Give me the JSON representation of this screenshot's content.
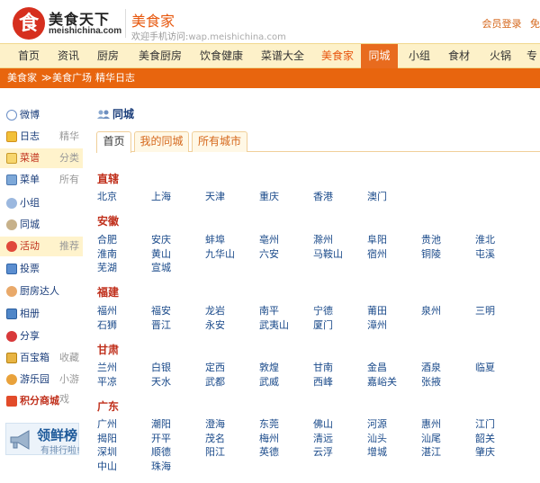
{
  "header": {
    "logo_mark": "食",
    "logo_name": "美食天下",
    "logo_domain": "meishichina.com",
    "site_title": "美食家",
    "site_sub_prefix": "欢迎手机访问:",
    "site_sub_wap": "wap.meishichina.com",
    "top_links": [
      "会员登录",
      "免"
    ]
  },
  "nav": {
    "items": [
      {
        "label": "首页"
      },
      {
        "label": "资讯"
      },
      {
        "label": "厨房"
      },
      {
        "label": "美食厨房"
      },
      {
        "label": "饮食健康"
      },
      {
        "label": "菜谱大全"
      },
      {
        "label": "美食家"
      },
      {
        "label": "同城"
      },
      {
        "label": "小组"
      },
      {
        "label": "食材"
      },
      {
        "label": "火锅"
      },
      {
        "label": "专"
      }
    ]
  },
  "subnav": {
    "items": [
      "美食家",
      "美食广场",
      "精华日志"
    ],
    "separator": "≫"
  },
  "sidebar": {
    "items": [
      {
        "label": "微博",
        "extra": "",
        "icon": "weibo-icon"
      },
      {
        "label": "日志",
        "extra": "精华",
        "icon": "log-icon"
      },
      {
        "label": "菜谱",
        "extra": "分类",
        "icon": "recipe-icon"
      },
      {
        "label": "菜单",
        "extra": "所有",
        "icon": "menu-icon"
      },
      {
        "label": "小组",
        "extra": "",
        "icon": "group-icon"
      },
      {
        "label": "同城",
        "extra": "",
        "icon": "city-icon"
      },
      {
        "label": "活动",
        "extra": "推荐",
        "icon": "activity-icon"
      },
      {
        "label": "投票",
        "extra": "",
        "icon": "vote-icon"
      },
      {
        "label": "厨房达人",
        "extra": "",
        "icon": "chef-icon"
      },
      {
        "label": "相册",
        "extra": "",
        "icon": "album-icon"
      },
      {
        "label": "分享",
        "extra": "",
        "icon": "share-icon"
      },
      {
        "label": "百宝箱",
        "extra": "收藏",
        "icon": "treasure-icon"
      },
      {
        "label": "游乐园",
        "extra": "小游戏",
        "icon": "game-icon"
      },
      {
        "label": "积分商城",
        "extra": "",
        "icon": "mall-icon"
      }
    ],
    "ranking_title": "领鲜榜",
    "ranking_sub": "有排行啦!"
  },
  "content": {
    "title": "同城",
    "tabs": [
      "首页",
      "我的同城",
      "所有城市"
    ],
    "regions": [
      {
        "name": "直辖",
        "cities": [
          "北京",
          "上海",
          "天津",
          "重庆",
          "香港",
          "澳门"
        ]
      },
      {
        "name": "安徽",
        "cities": [
          "合肥",
          "安庆",
          "蚌埠",
          "亳州",
          "滁州",
          "阜阳",
          "贵池",
          "淮北",
          "淮南",
          "黄山",
          "九华山",
          "六安",
          "马鞍山",
          "宿州",
          "铜陵",
          "屯溪",
          "芜湖",
          "宣城"
        ]
      },
      {
        "name": "福建",
        "cities": [
          "福州",
          "福安",
          "龙岩",
          "南平",
          "宁德",
          "莆田",
          "泉州",
          "三明",
          "石狮",
          "晋江",
          "永安",
          "武夷山",
          "厦门",
          "漳州"
        ]
      },
      {
        "name": "甘肃",
        "cities": [
          "兰州",
          "白银",
          "定西",
          "敦煌",
          "甘南",
          "金昌",
          "酒泉",
          "临夏",
          "平凉",
          "天水",
          "武都",
          "武威",
          "西峰",
          "嘉峪关",
          "张掖"
        ]
      },
      {
        "name": "广东",
        "cities": [
          "广州",
          "潮阳",
          "澄海",
          "东莞",
          "佛山",
          "河源",
          "惠州",
          "江门",
          "揭阳",
          "开平",
          "茂名",
          "梅州",
          "清远",
          "汕头",
          "汕尾",
          "韶关",
          "深圳",
          "顺德",
          "阳江",
          "英德",
          "云浮",
          "增城",
          "湛江",
          "肇庆",
          "中山",
          "珠海"
        ]
      }
    ]
  }
}
